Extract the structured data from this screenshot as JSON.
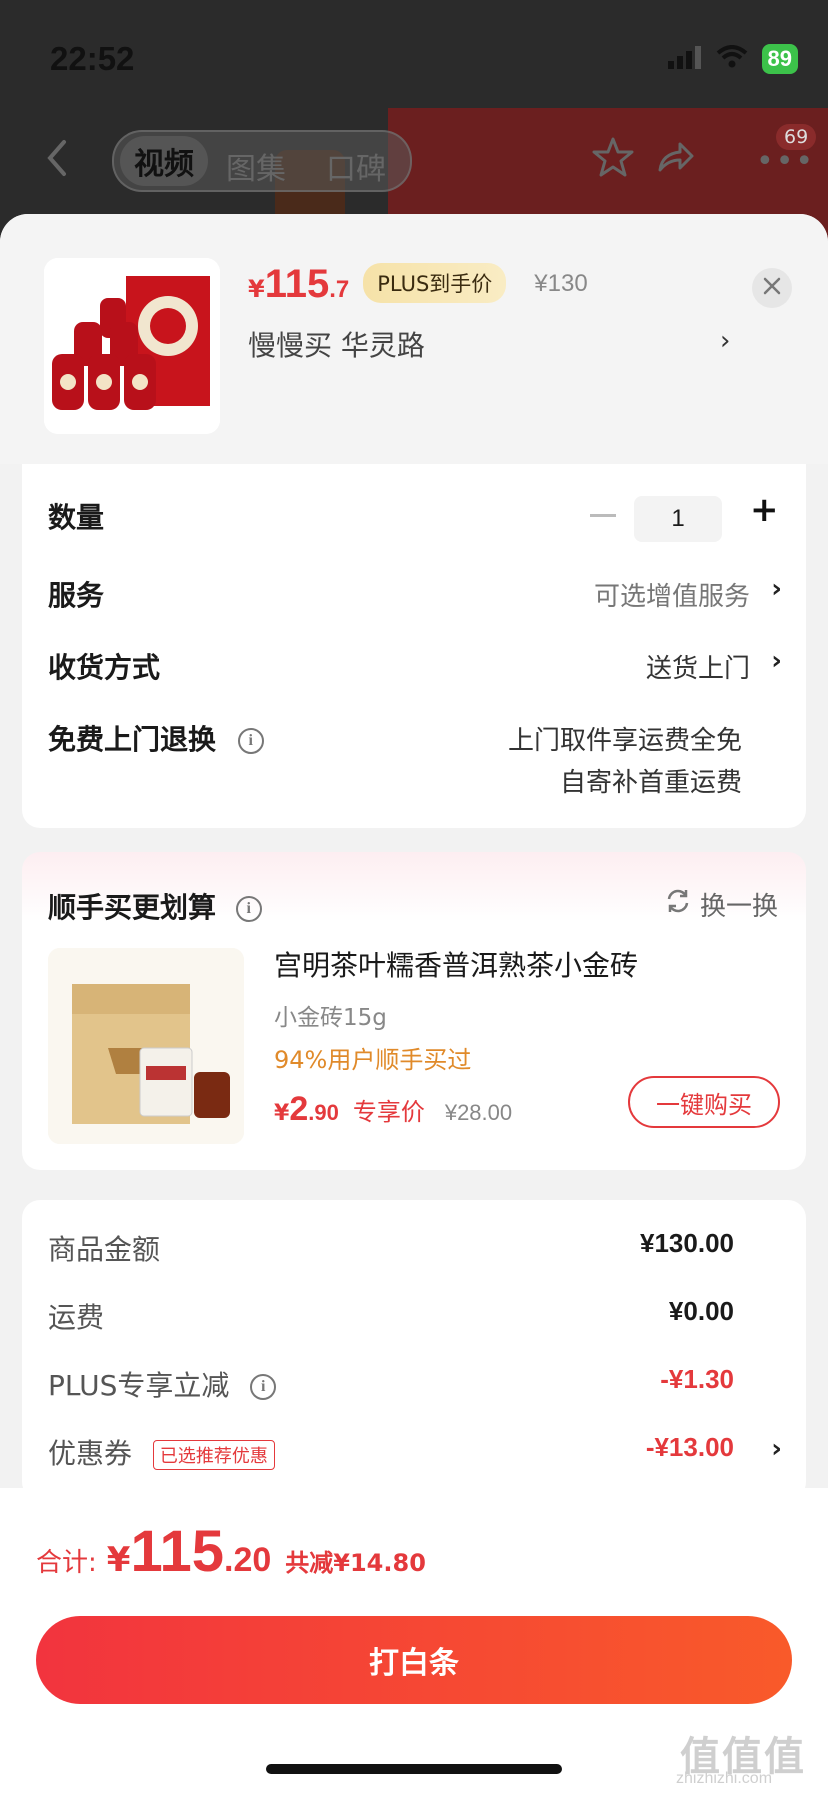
{
  "status_bar": {
    "time": "22:52",
    "battery": "89"
  },
  "nav": {
    "tabs": [
      {
        "label": "视频",
        "active": true
      },
      {
        "label": "图集",
        "active": false
      },
      {
        "label": "口碑",
        "active": false
      }
    ],
    "badge": "69"
  },
  "product": {
    "price_yen": "¥",
    "price_int": "115",
    "price_dec": ".7",
    "plus_badge": "PLUS到手价",
    "orig_price": "¥130",
    "shop_line": "慢慢买  华灵路"
  },
  "options": {
    "quantity": {
      "label": "数量",
      "value": "1"
    },
    "service": {
      "label": "服务",
      "value": "可选增值服务"
    },
    "delivery": {
      "label": "收货方式",
      "value": "送货上门"
    },
    "return": {
      "label": "免费上门退换",
      "line1": "上门取件享运费全免",
      "line2": "自寄补首重运费"
    }
  },
  "recommend": {
    "title": "顺手买更划算",
    "swap": "换一换",
    "name": "宫明茶叶糯香普洱熟茶小金砖",
    "spec": "小金砖15g",
    "bought": "94%用户顺手买过",
    "price_yen": "¥",
    "price_int": "2",
    "price_dec": ".90",
    "price_tag": "专享价",
    "orig_price": "¥28.00",
    "buy_label": "一键购买"
  },
  "summary": {
    "items": [
      {
        "label": "商品金额",
        "value": "¥130.00"
      },
      {
        "label": "运费",
        "value": "¥0.00"
      },
      {
        "label": "PLUS专享立减",
        "value": "-¥1.30"
      },
      {
        "label": "优惠券",
        "value": "-¥13.00",
        "tag": "已选推荐优惠"
      }
    ]
  },
  "footer": {
    "total_label": "合计:",
    "total_yen": "¥",
    "total_int": "115",
    "total_dec": ".20",
    "total_save": "共减¥14.80",
    "pay_label": "打白条",
    "watermark": "值值值",
    "watermark_sub": "zhizhizhi.com"
  },
  "colors": {
    "accent": "#e4393c",
    "plus_gold": "#f6e2a8",
    "bought_orange": "#e08a2a"
  },
  "icons": [
    "back-icon",
    "star-icon",
    "share-icon",
    "more-icon",
    "close-icon",
    "info-icon",
    "refresh-icon",
    "chevron-right-icon",
    "plus-icon",
    "minus-icon"
  ]
}
